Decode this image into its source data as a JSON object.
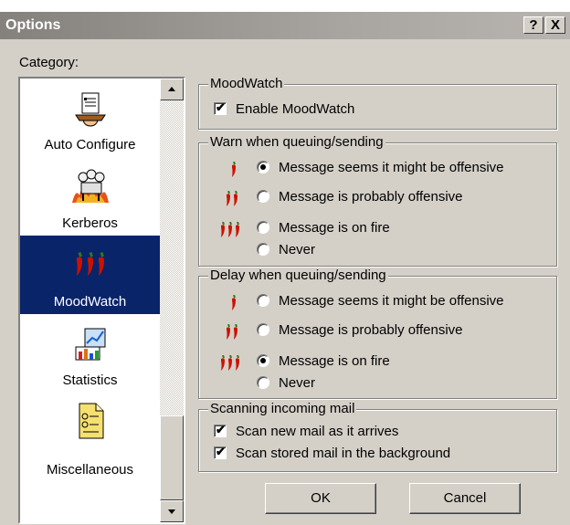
{
  "window": {
    "title": "Options",
    "help_label": "?",
    "close_label": "X"
  },
  "category": {
    "label": "Category:",
    "items": [
      {
        "label": "Auto Configure",
        "icon": "auto-configure-icon",
        "selected": false
      },
      {
        "label": "Kerberos",
        "icon": "kerberos-icon",
        "selected": false
      },
      {
        "label": "MoodWatch",
        "icon": "chili-peppers-icon",
        "selected": true
      },
      {
        "label": "Statistics",
        "icon": "statistics-icon",
        "selected": false
      },
      {
        "label": "Miscellaneous",
        "icon": "miscellaneous-icon",
        "selected": false
      }
    ]
  },
  "moodwatch": {
    "title": "MoodWatch",
    "enable_label": "Enable MoodWatch",
    "enable_checked": true
  },
  "warn": {
    "title": "Warn when queuing/sending",
    "options": [
      {
        "label": "Message seems it might be offensive",
        "peppers": 1,
        "selected": true
      },
      {
        "label": "Message is probably offensive",
        "peppers": 2,
        "selected": false
      },
      {
        "label": "Message is on fire",
        "peppers": 3,
        "selected": false
      },
      {
        "label": "Never",
        "peppers": 0,
        "selected": false
      }
    ]
  },
  "delay": {
    "title": "Delay when queuing/sending",
    "options": [
      {
        "label": "Message seems it might be offensive",
        "peppers": 1,
        "selected": false
      },
      {
        "label": "Message is probably offensive",
        "peppers": 2,
        "selected": false
      },
      {
        "label": "Message is on fire",
        "peppers": 3,
        "selected": true
      },
      {
        "label": "Never",
        "peppers": 0,
        "selected": false
      }
    ]
  },
  "scanning": {
    "title": "Scanning incoming mail",
    "options": [
      {
        "label": "Scan new mail as it arrives",
        "checked": true
      },
      {
        "label": "Scan stored mail in the background",
        "checked": true
      }
    ]
  },
  "buttons": {
    "ok": "OK",
    "cancel": "Cancel"
  },
  "colors": {
    "selection": "#0a246a",
    "pepper": "#cc1100",
    "dialog": "#d4d0c8"
  }
}
